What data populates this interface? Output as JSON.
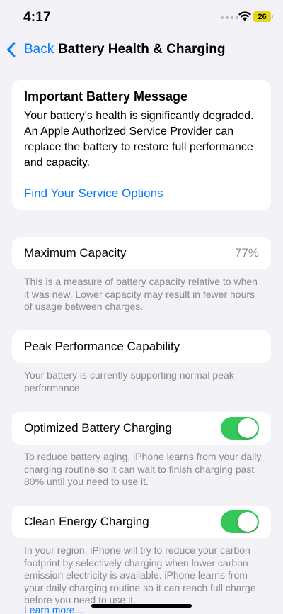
{
  "status_bar": {
    "time": "4:17",
    "battery_level": "26",
    "battery_color": "#E3D51A",
    "icons": [
      "cellular-dots-icon",
      "wifi-icon",
      "battery-icon"
    ]
  },
  "nav": {
    "back_label": "Back",
    "title": "Battery Health & Charging",
    "accent_color": "#0A7AFF"
  },
  "message": {
    "title": "Important Battery Message",
    "body": "Your battery's health is significantly degraded. An Apple Authorized Service Provider can replace the battery to restore full performance and capacity.",
    "link": "Find Your Service Options"
  },
  "maximum_capacity": {
    "label": "Maximum Capacity",
    "value": "77%",
    "footer": "This is a measure of battery capacity relative to when it was new. Lower capacity may result in fewer hours of usage between charges."
  },
  "peak_performance": {
    "label": "Peak Performance Capability",
    "footer": "Your battery is currently supporting normal peak performance."
  },
  "optimized_charging": {
    "label": "Optimized Battery Charging",
    "enabled": true,
    "footer": "To reduce battery aging, iPhone learns from your daily charging routine so it can wait to finish charging past 80% until you need to use it."
  },
  "clean_energy": {
    "label": "Clean Energy Charging",
    "enabled": true,
    "footer": "In your region, iPhone will try to reduce your carbon footprint by selectively charging when lower carbon emission electricity is available. iPhone learns from your daily charging routine so it can reach full charge before you need to use it.",
    "learn_more": "Learn more..."
  },
  "toggle_on_color": "#34C759"
}
